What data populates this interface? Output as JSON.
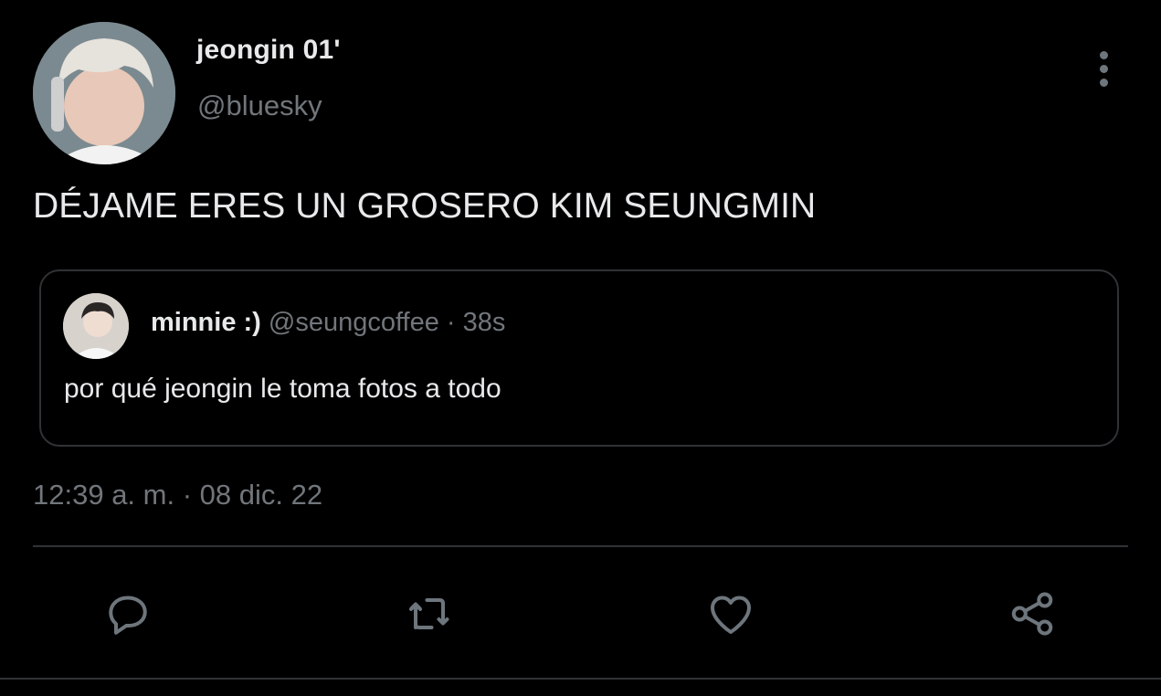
{
  "author": {
    "display_name": "jeongin 01'",
    "handle": "@bluesky"
  },
  "tweet": {
    "text": "DÉJAME ERES UN GROSERO KIM SEUNGMIN",
    "timestamp": "12:39 a. m. · 08 dic. 22"
  },
  "quoted_tweet": {
    "display_name": "minnie :)",
    "handle": "@seungcoffee",
    "separator": "·",
    "time_ago": "38s",
    "text": "por qué jeongin le toma fotos a todo"
  },
  "actions": {
    "reply_icon": "comment-icon",
    "retweet_icon": "retweet-icon",
    "like_icon": "heart-icon",
    "share_icon": "share-icon"
  },
  "colors": {
    "background": "#000000",
    "primary_text": "#e7e9ea",
    "secondary_text": "#71767b",
    "border": "#2f3336",
    "icon": "#6e767d"
  }
}
